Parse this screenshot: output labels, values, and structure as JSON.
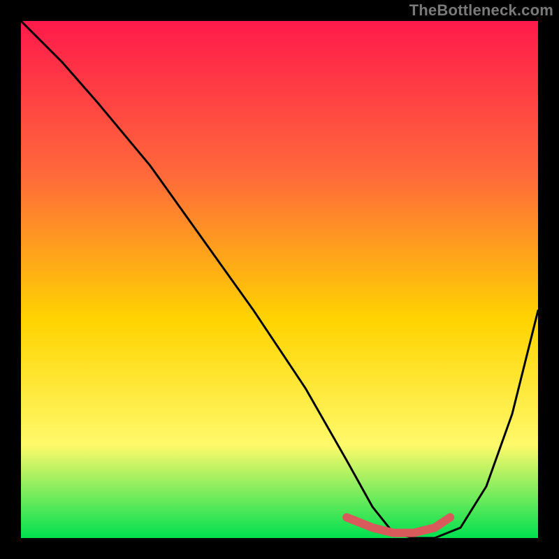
{
  "watermark": "TheBottleneck.com",
  "colors": {
    "frame": "#000000",
    "gradient_top": "#ff1a4b",
    "gradient_mid_upper": "#ff6a3a",
    "gradient_mid": "#ffd400",
    "gradient_lower": "#fff96a",
    "gradient_bottom": "#00e050",
    "curve": "#000000",
    "highlight": "#d85a5a"
  },
  "chart_data": {
    "type": "line",
    "title": "",
    "xlabel": "",
    "ylabel": "",
    "xlim": [
      0,
      100
    ],
    "ylim": [
      0,
      100
    ],
    "series": [
      {
        "name": "bottleneck-curve",
        "x": [
          0,
          3,
          8,
          15,
          25,
          35,
          45,
          55,
          63,
          68,
          72,
          76,
          80,
          85,
          90,
          95,
          100
        ],
        "values": [
          100,
          97,
          92,
          84,
          72,
          58,
          44,
          29,
          15,
          6,
          1,
          0,
          0,
          2,
          10,
          24,
          44
        ]
      }
    ],
    "highlight_segment": {
      "name": "trough-highlight",
      "x": [
        63,
        68,
        72,
        76,
        80,
        83
      ],
      "values": [
        4,
        2,
        1,
        1,
        2,
        4
      ]
    }
  }
}
